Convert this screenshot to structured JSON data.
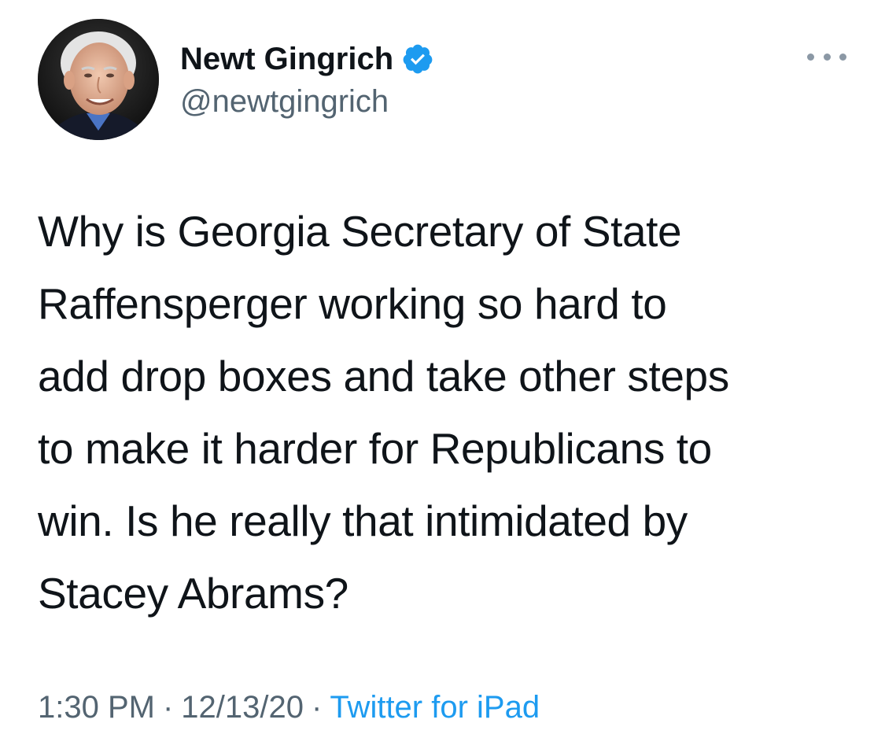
{
  "author": {
    "display_name": "Newt Gingrich",
    "handle": "@newtgingrich",
    "verified": true
  },
  "more_icon": "more-horizontal-icon",
  "verified_icon": "verified-badge-icon",
  "tweet": {
    "lines": [
      "Why is Georgia Secretary of State",
      "Raffensperger working so hard to",
      "add drop boxes and take other steps",
      "to make it harder for Republicans to",
      "win. Is he really that intimidated by",
      "Stacey Abrams?"
    ]
  },
  "meta": {
    "time": "1:30 PM",
    "separator": "·",
    "date": "12/13/20",
    "source": "Twitter for iPad"
  },
  "colors": {
    "text": "#0f1419",
    "secondary": "#536471",
    "link": "#1d9bf0",
    "verified": "#1d9bf0"
  }
}
